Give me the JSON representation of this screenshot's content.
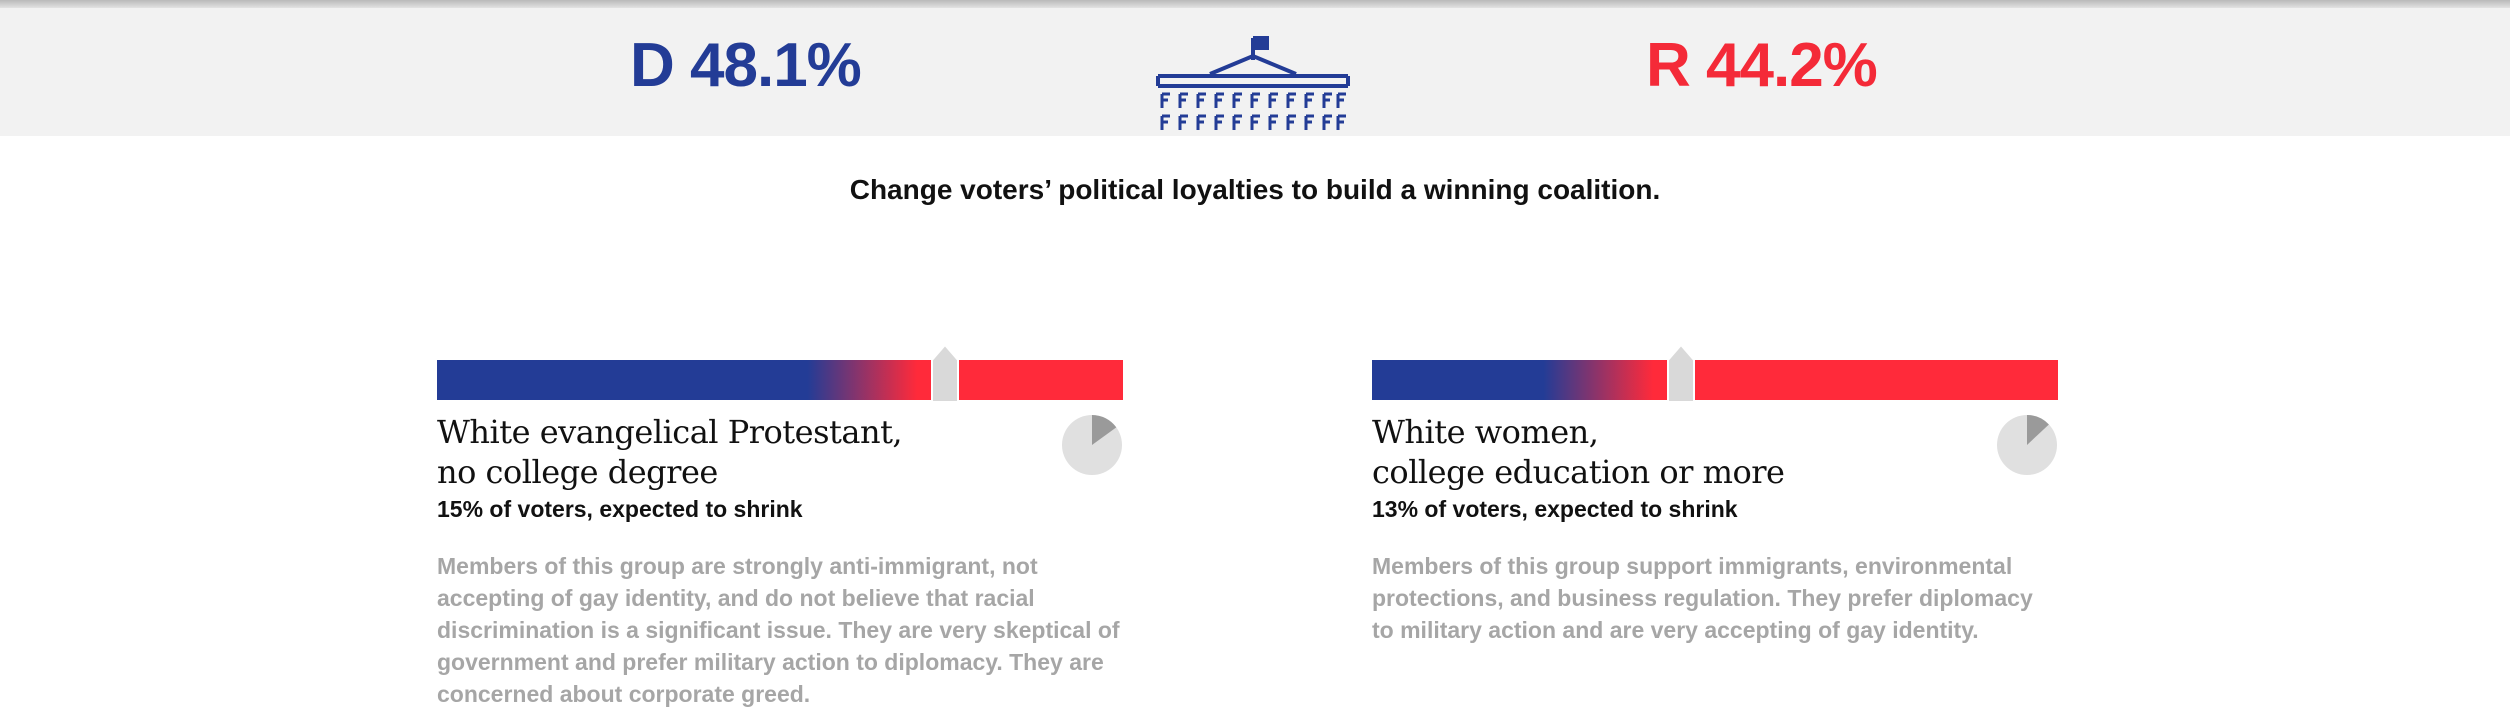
{
  "scoreboard": {
    "democrat": {
      "label": "D 48.1%",
      "color": "#233c96"
    },
    "republican": {
      "label": "R 44.2%",
      "color": "#f42a38"
    },
    "center_icon": "capitol-building-icon"
  },
  "tagline": "Change voters’ political loyalties to build a winning coalition.",
  "colors": {
    "democrat_blue": "#233c96",
    "republican_red": "#ff2a3a",
    "muted_text": "#a6a6a6",
    "pie_bg": "#e0e0e0",
    "pie_slice": "#9a9a9a"
  },
  "groups": [
    {
      "title_line1": "White evangelical Protestant,",
      "title_line2": "no college degree",
      "share": "15% of voters, expected to shrink",
      "description": "Members of this group are strongly anti-immigrant, not accepting of gay identity, and do not believe that racial discrimination is a significant issue. They are very skeptical of government and prefer military action to diplomacy. They are concerned about corporate greed.",
      "slider_value": 0.74,
      "pie_share": 0.15
    },
    {
      "title_line1": "White women,",
      "title_line2": "college education or more",
      "share": "13% of voters, expected to shrink",
      "description": "Members of this group support immigrants, environmental protections, and business regulation. They prefer diplomacy to military action and are very accepting of gay identity.",
      "slider_value": 0.45,
      "pie_share": 0.13
    }
  ]
}
